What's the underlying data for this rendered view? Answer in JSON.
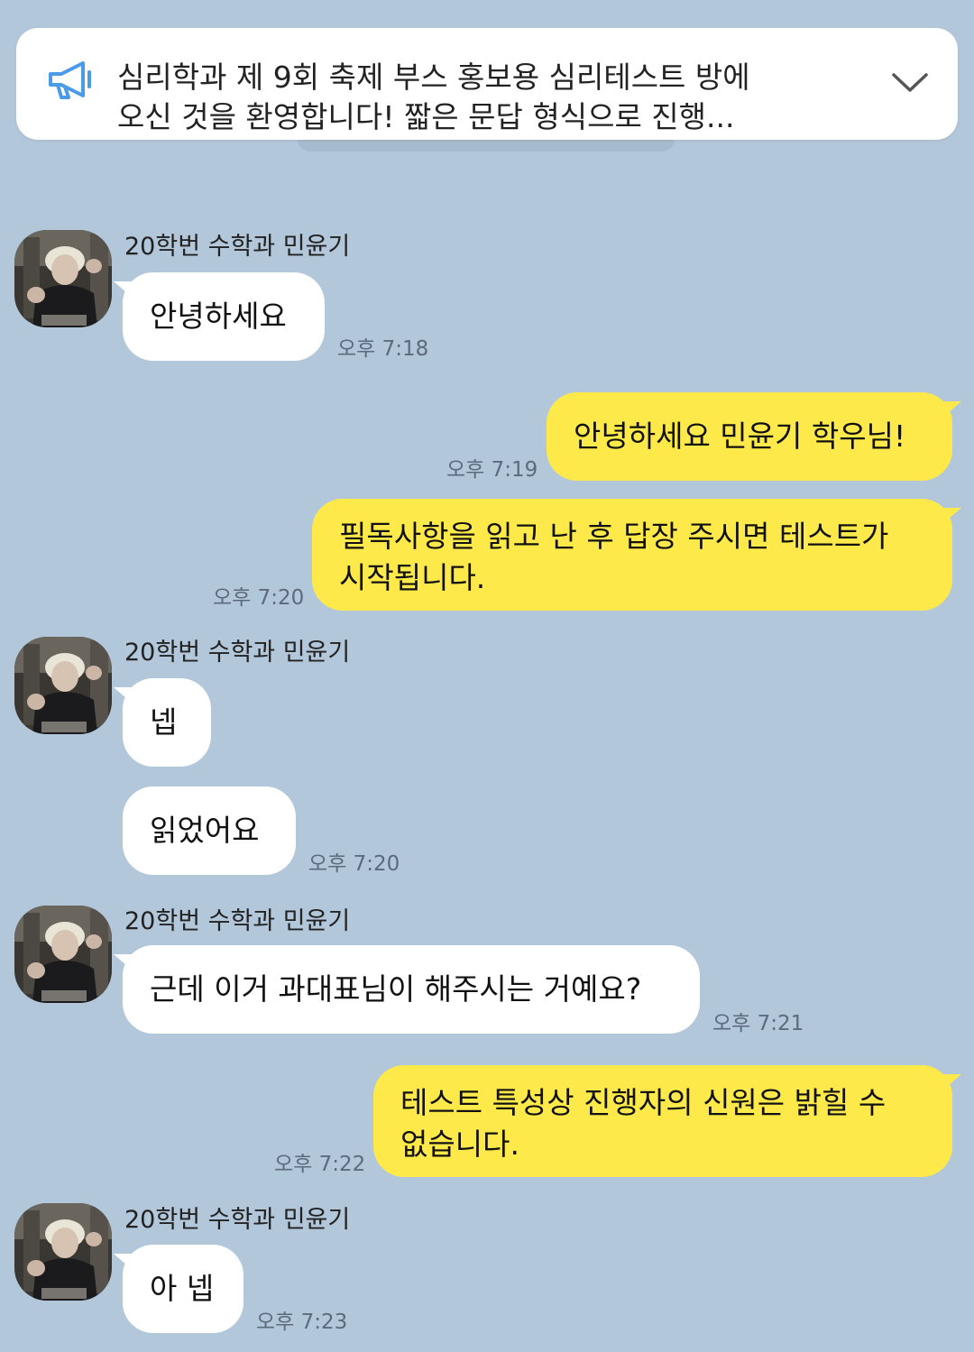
{
  "notice": {
    "icon": "megaphone-icon",
    "text": "심리학과 제 9회 축제 부스 홍보용 심리테스트 방에\n오신 것을 환영합니다! 짧은 문답 형식으로 진행...",
    "expand_icon": "chevron-down-icon"
  },
  "colors": {
    "background": "#b2c7da",
    "incoming_bubble": "#ffffff",
    "outgoing_bubble": "#fee94a",
    "notice_icon": "#4a9be8"
  },
  "messages": [
    {
      "sender": "20학번 수학과 민윤기",
      "text": "안녕하세요",
      "time": "오후 7:18"
    },
    {
      "text": "안녕하세요 민윤기 학우님!",
      "time": "오후 7:19"
    },
    {
      "text": "필독사항을 읽고 난 후 답장 주시면 테스트가\n시작됩니다.",
      "time": "오후 7:20"
    },
    {
      "sender": "20학번 수학과 민윤기",
      "text": "넵"
    },
    {
      "text": "읽었어요",
      "time": "오후 7:20"
    },
    {
      "sender": "20학번 수학과 민윤기",
      "text": "근데 이거 과대표님이 해주시는 거예요?",
      "time": "오후 7:21"
    },
    {
      "text": "테스트 특성상 진행자의 신원은 밝힐 수\n없습니다.",
      "time": "오후 7:22"
    },
    {
      "sender": "20학번 수학과 민윤기",
      "text": "아 넵",
      "time": "오후 7:23"
    }
  ]
}
